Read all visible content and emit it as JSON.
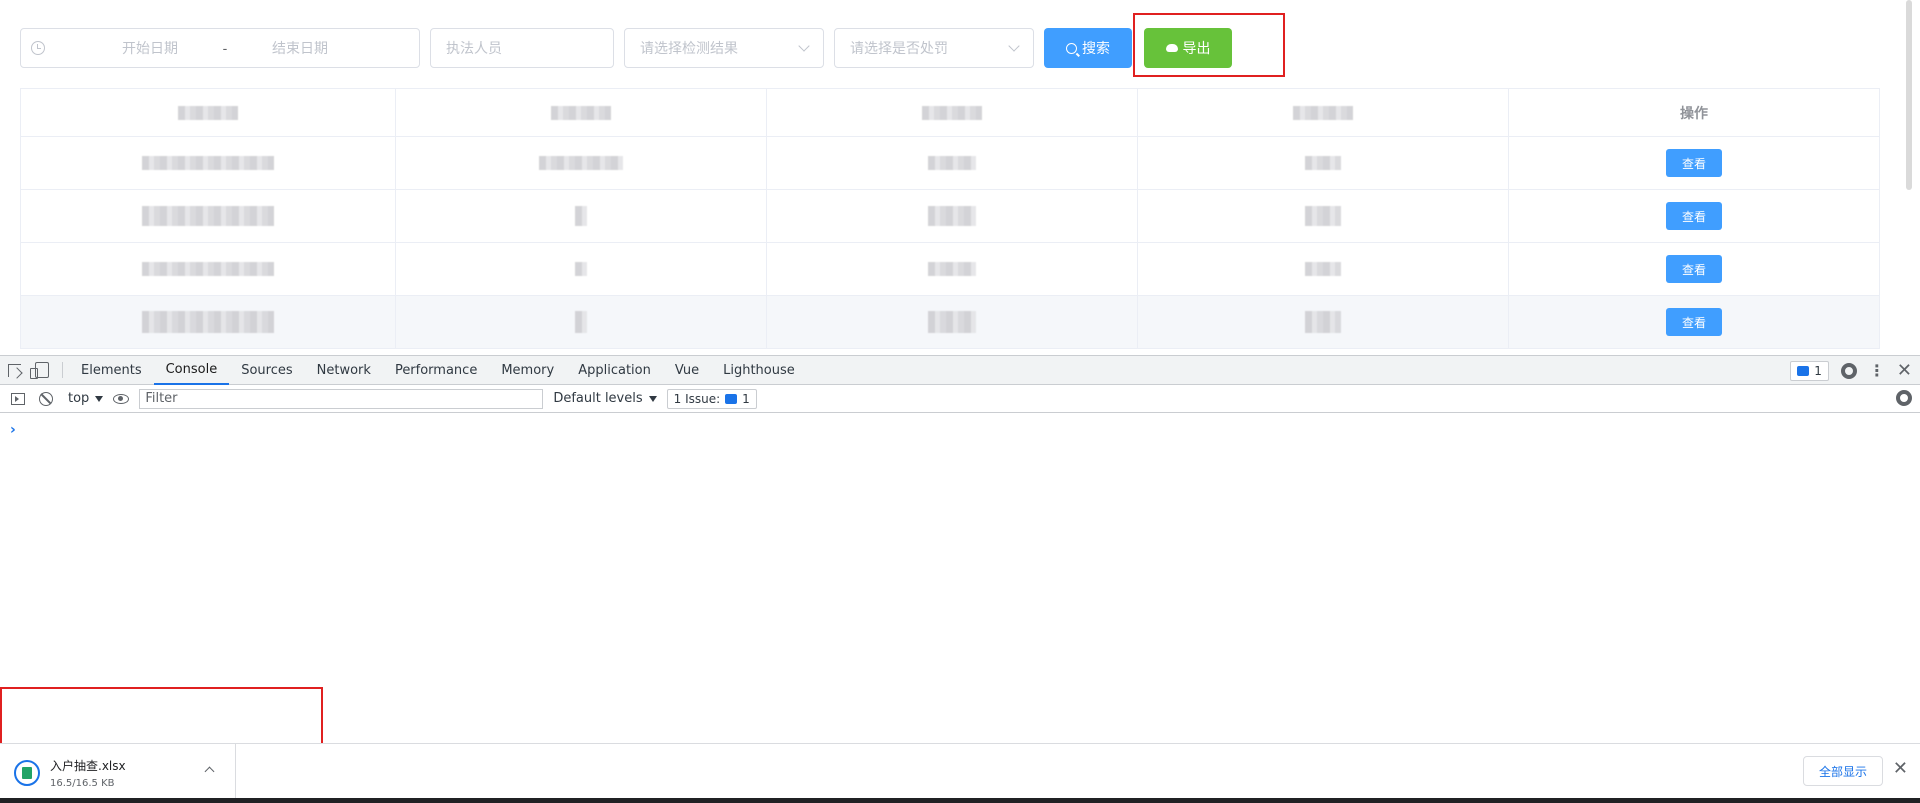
{
  "filters": {
    "date_start_placeholder": "开始日期",
    "date_sep": "-",
    "date_end_placeholder": "结束日期",
    "person_placeholder": "执法人员",
    "result_placeholder": "请选择检测结果",
    "penalty_placeholder": "请选择是否处罚",
    "search_label": "搜索",
    "export_label": "导出"
  },
  "table": {
    "op_header": "操作",
    "view_label": "查看"
  },
  "devtools": {
    "tabs": [
      "Elements",
      "Console",
      "Sources",
      "Network",
      "Performance",
      "Memory",
      "Application",
      "Vue",
      "Lighthouse"
    ],
    "active_tab": "Console",
    "message_count": "1",
    "context": "top",
    "filter_placeholder": "Filter",
    "levels_label": "Default levels",
    "issue_label": "1 Issue:",
    "issue_count": "1",
    "prompt": "›"
  },
  "download": {
    "file_name": "入户抽查.xlsx",
    "file_size": "16.5/16.5 KB",
    "show_all": "全部显示",
    "close": "✕"
  },
  "colors": {
    "primary": "#409eff",
    "success": "#67c23a",
    "highlight": "#e02020",
    "devtools_accent": "#1a73e8"
  }
}
